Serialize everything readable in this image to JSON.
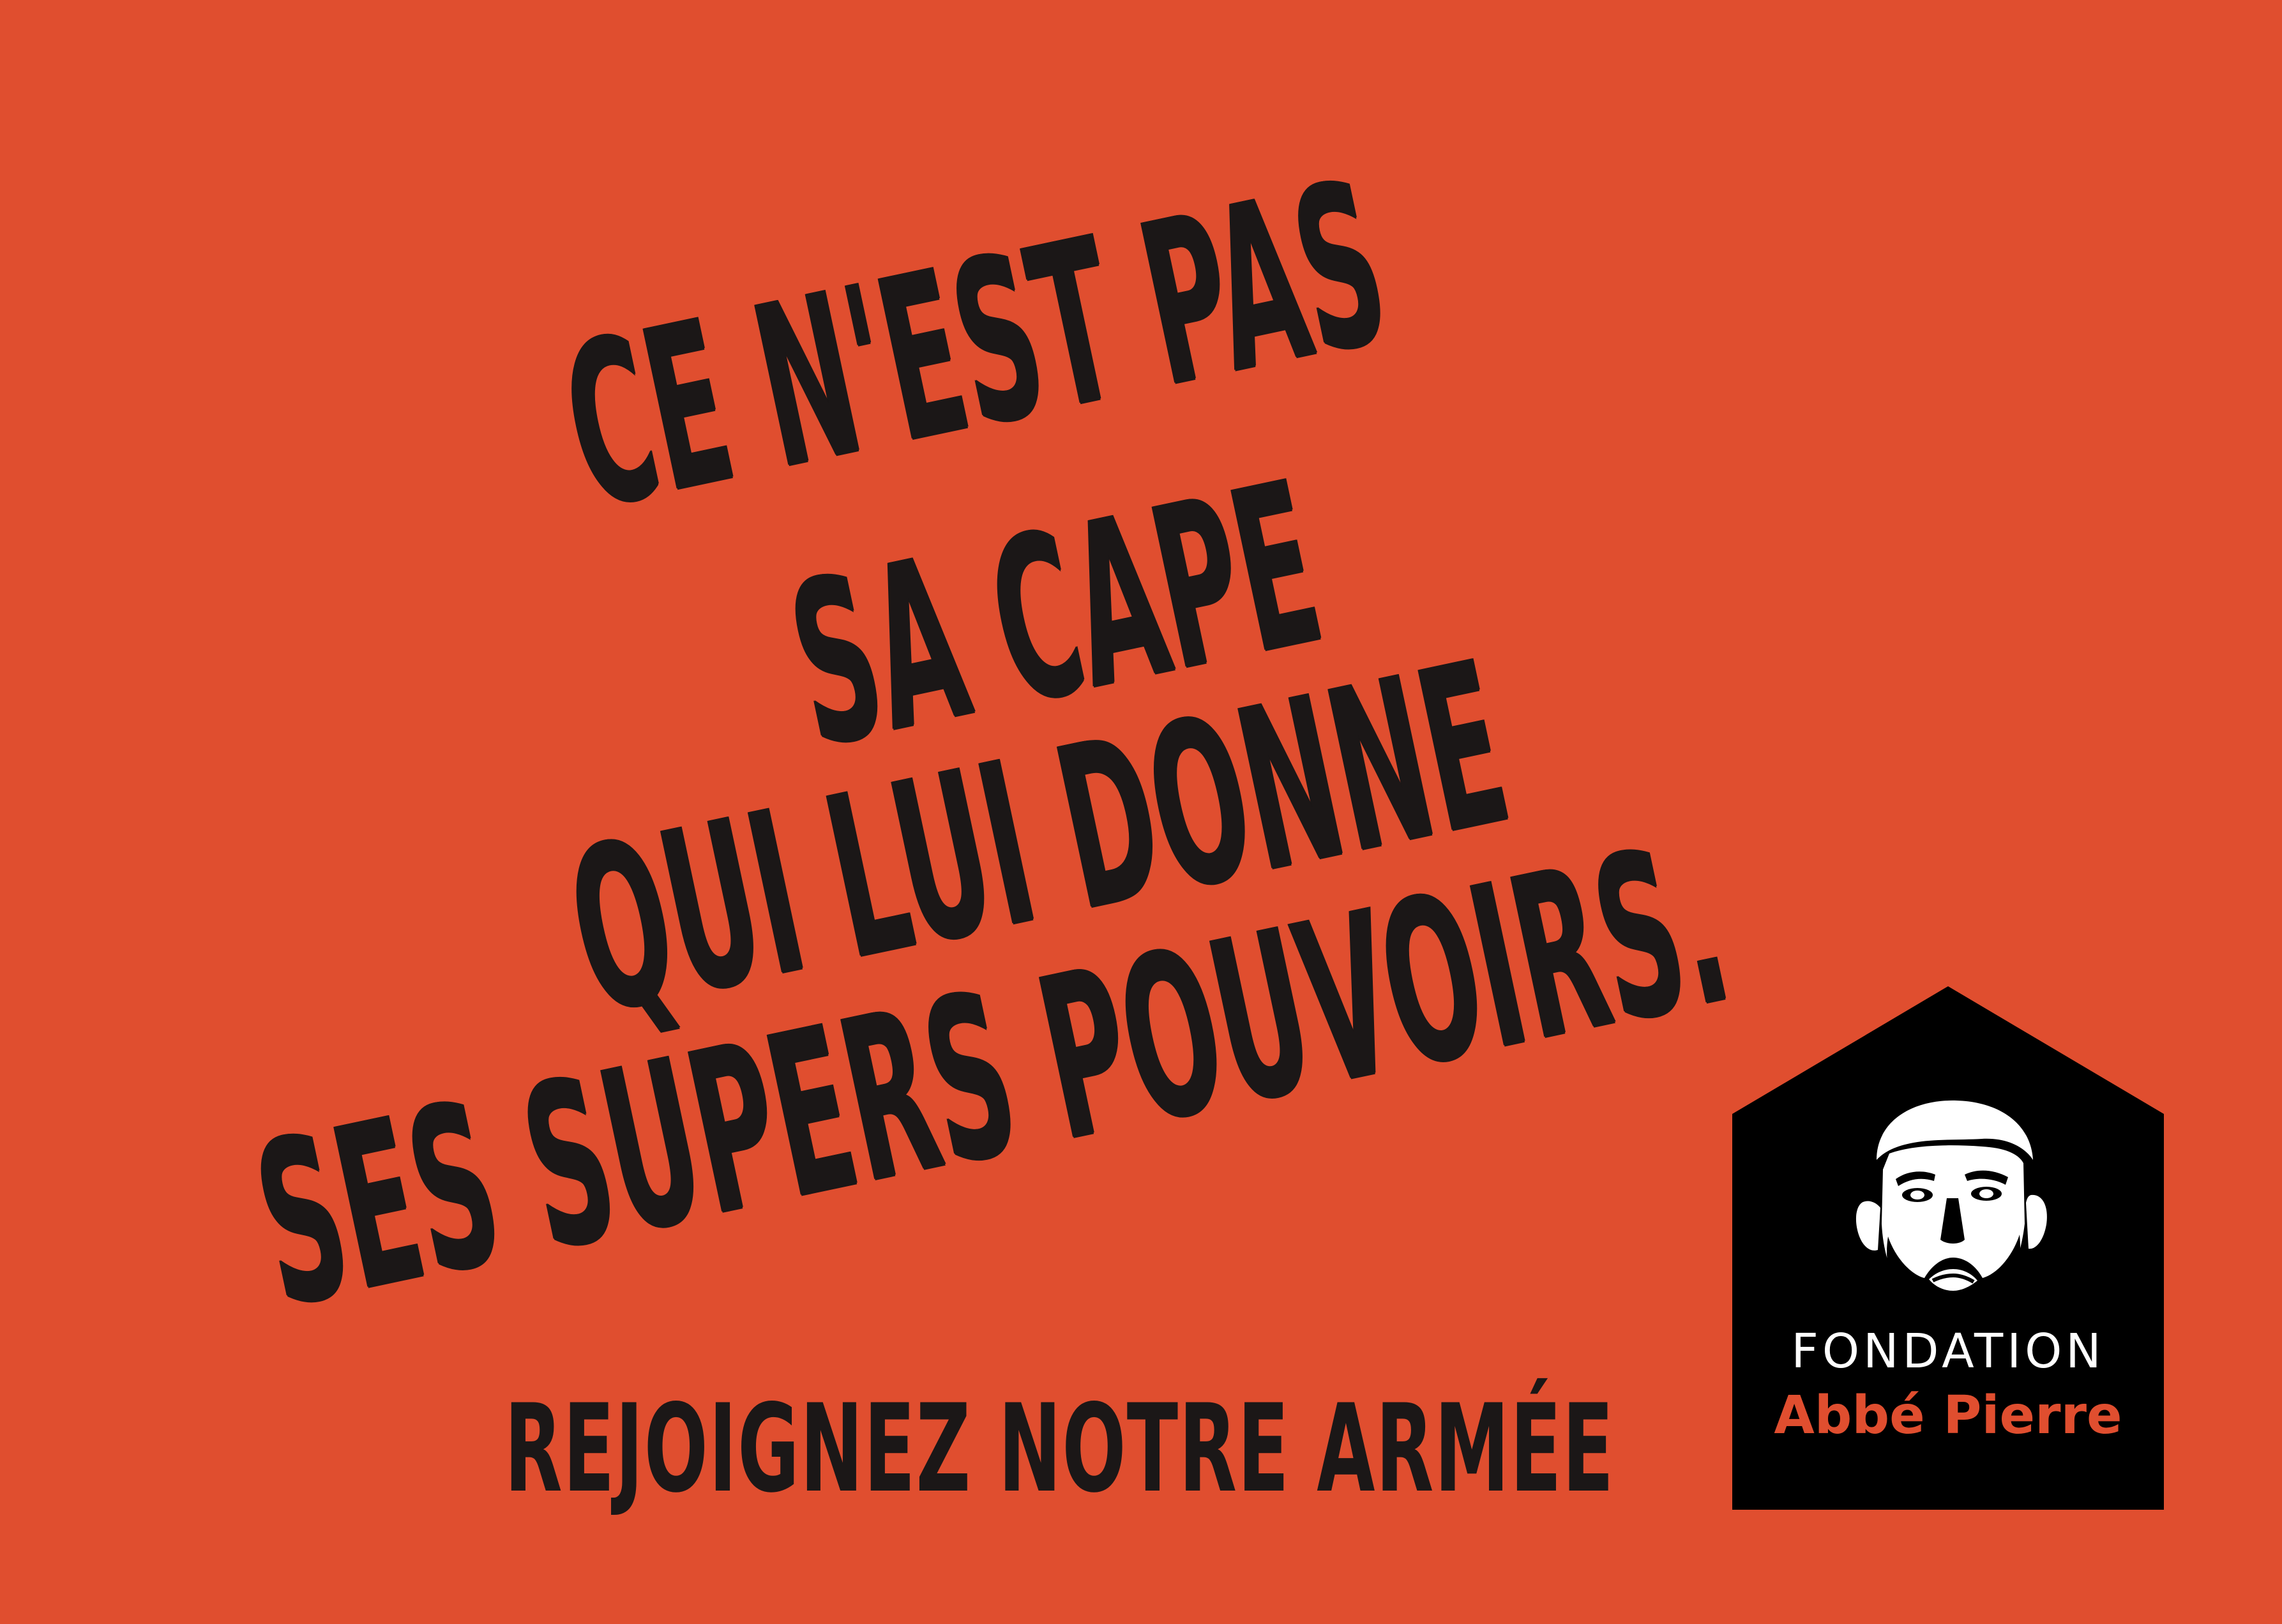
{
  "poster": {
    "headline": {
      "line1": "CE N'EST PAS",
      "line2": "SA CAPE",
      "line3": "QUI LUI DONNE",
      "line4": "SES SUPERS POUVOIRS."
    },
    "call_to_action": "REJOIGNEZ NOTRE ARMÉE"
  },
  "logo": {
    "title": "FONDATION",
    "subtitle": "Abbé Pierre",
    "icon": "portrait-icon"
  },
  "colors": {
    "background": "#e04e2f",
    "text": "#1b1717",
    "logo_background": "#000000",
    "logo_title": "#ffffff",
    "logo_subtitle": "#e04e2f"
  }
}
